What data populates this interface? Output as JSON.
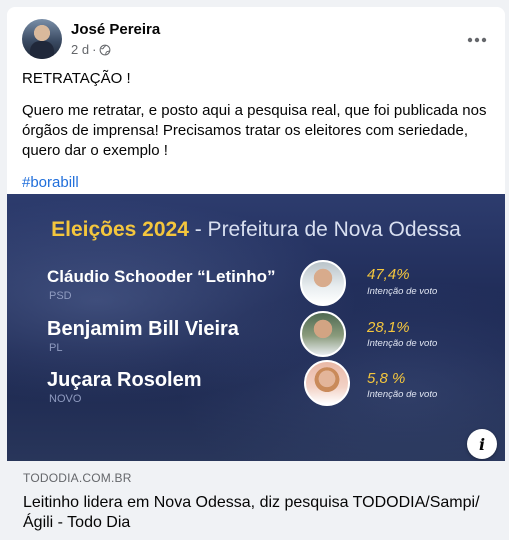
{
  "post": {
    "author": "José Pereira",
    "time": "2 d",
    "separator": "·",
    "paragraphs": [
      "RETRATAÇÃO !",
      "Quero me retratar, e posto aqui a pesquisa real, que foi publicada nos órgãos  de imprensa! Precisamos tratar os eleitores com seriedade, quero dar o exemplo !"
    ],
    "hashtag": "#borabill"
  },
  "banner": {
    "title_year": "Eleições 2024",
    "title_rest": "- Prefeitura de Nova Odessa",
    "intent_label": "Intenção de voto",
    "candidates": [
      {
        "name": "Cláudio Schooder “Letinho”",
        "party": "PSD",
        "percent": "47,4%"
      },
      {
        "name": "Benjamim Bill Vieira",
        "party": "PL",
        "percent": "28,1%"
      },
      {
        "name": "Juçara Rosolem",
        "party": "NOVO",
        "percent": "5,8 %"
      }
    ]
  },
  "link": {
    "domain": "TODODIA.COM.BR",
    "title": "Leitinho lidera em Nova Odessa, diz pesquisa TODODIA/Sampi/Ágili - Todo Dia"
  },
  "icons": {
    "more": "more-horizontal-icon",
    "privacy": "globe-icon",
    "info": "info-icon"
  },
  "colors": {
    "hashtag": "#216fdb",
    "banner_bg": "#1e2a55",
    "accent_yellow": "#f4c63d"
  }
}
